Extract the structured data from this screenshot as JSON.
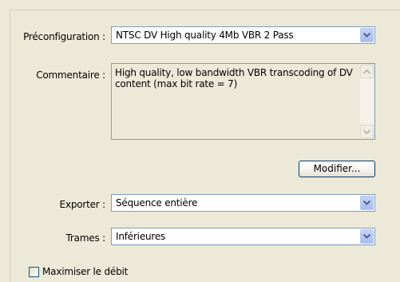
{
  "form": {
    "preset_label": "Préconfiguration :",
    "preset_value": "NTSC DV High quality 4Mb VBR 2 Pass",
    "comment_label": "Commentaire :",
    "comment_text": "High quality, low bandwidth VBR transcoding of DV content (max bit rate = 7)",
    "modify_button": "Modifier...",
    "export_label": "Exporter :",
    "export_value": "Séquence entière",
    "fields_label": "Trames :",
    "fields_value": "Inférieures",
    "maximize_label": "Maximiser le débit",
    "maximize_checked": false
  },
  "icons": {
    "dropdown": "chevron-down-icon",
    "scroll_up": "scroll-up-arrow-icon",
    "scroll_down": "scroll-down-arrow-icon"
  }
}
